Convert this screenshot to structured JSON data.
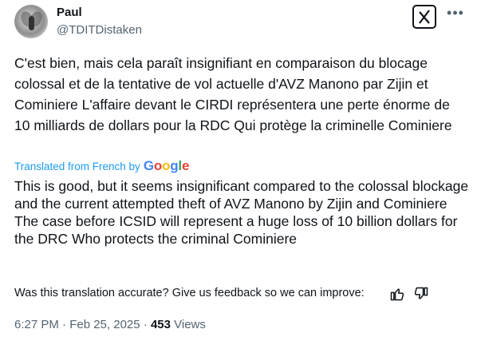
{
  "author": {
    "name": "Paul",
    "handle": "@TDITDistaken"
  },
  "original_text": "C'est bien, mais cela paraît insignifiant en comparaison du blocage colossal et de la tentative de vol actuelle d'AVZ Manono par Zijin et Cominiere L'affaire devant le CIRDI représentera une perte énorme de 10 milliards de dollars pour la RDC Qui protège la criminelle Cominiere",
  "translation_label": "Translated from French by",
  "translation_provider": "Google",
  "translated_text": "This is good, but it seems insignificant compared to the colossal blockage and the current attempted theft of AVZ Manono by Zijin and Cominiere The case before ICSID will represent a huge loss of 10 billion dollars for the DRC Who protects the criminal Cominiere",
  "feedback_prompt": "Was this translation accurate? Give us feedback so we can improve:",
  "timestamp": "6:27 PM · Feb 25, 2025 ·",
  "views_count": "453",
  "views_label": "Views",
  "more_label": "•••",
  "colors": {
    "link": "#1d9bf0",
    "muted": "#536471",
    "text": "#0f1419"
  },
  "icons": [
    "grok-icon",
    "more-icon",
    "thumbs-up-icon",
    "thumbs-down-icon",
    "google-logo"
  ]
}
